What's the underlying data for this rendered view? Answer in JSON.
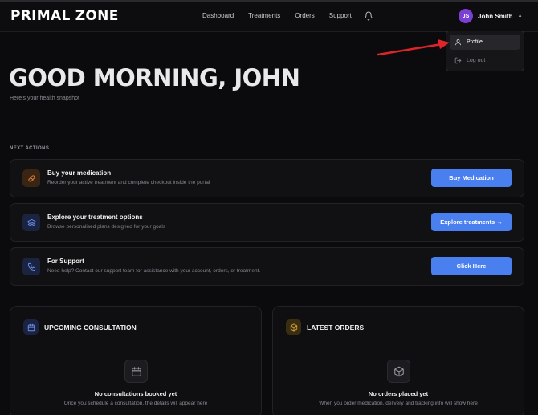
{
  "brand": {
    "logo": "PRIMAL ZONE"
  },
  "nav": {
    "links": [
      "Dashboard",
      "Treatments",
      "Orders",
      "Support"
    ],
    "icons": {
      "notifications": "bell-icon"
    }
  },
  "user": {
    "initials": "JS",
    "name": "John Smith",
    "avatar_color": "#7b3fd6"
  },
  "dropdown": {
    "items": [
      {
        "label": "Profile",
        "icon": "user-icon"
      },
      {
        "label": "Log out",
        "icon": "logout-icon"
      }
    ]
  },
  "annotation": {
    "arrow_color": "#e0242a"
  },
  "hero": {
    "greeting": "GOOD MORNING, JOHN",
    "subtitle": "Here's your health snapshot"
  },
  "next_actions": {
    "label": "NEXT ACTIONS",
    "cards": [
      {
        "title": "Buy your medication",
        "desc": "Reorder your active treatment and complete checkout inside the portal",
        "button": "Buy Medication",
        "icon": "pill-icon",
        "icon_color": "#e0803a"
      },
      {
        "title": "Explore your treatment options",
        "desc": "Browse personalised plans designed for your goals",
        "button": "Explore treatments →",
        "icon": "layers-icon",
        "icon_color": "#6e8ff0"
      },
      {
        "title": "For Support",
        "desc": "Need help? Contact our support team for assistance with your account, orders, or treatment.",
        "button": "Click Here",
        "icon": "phone-icon",
        "icon_color": "#6e8ff0"
      }
    ]
  },
  "panels": {
    "consultation": {
      "title": "UPCOMING CONSULTATION",
      "icon": "calendar-icon",
      "empty_title": "No consultations booked yet",
      "empty_desc": "Once you schedule a consultation, the details will appear here"
    },
    "orders": {
      "title": "LATEST ORDERS",
      "icon": "box-icon",
      "empty_title": "No orders placed yet",
      "empty_desc": "When you order medication, delivery and tracking info will show here"
    }
  },
  "colors": {
    "accent": "#4a7ff0",
    "background": "#0b0b0d",
    "card": "#111114"
  }
}
